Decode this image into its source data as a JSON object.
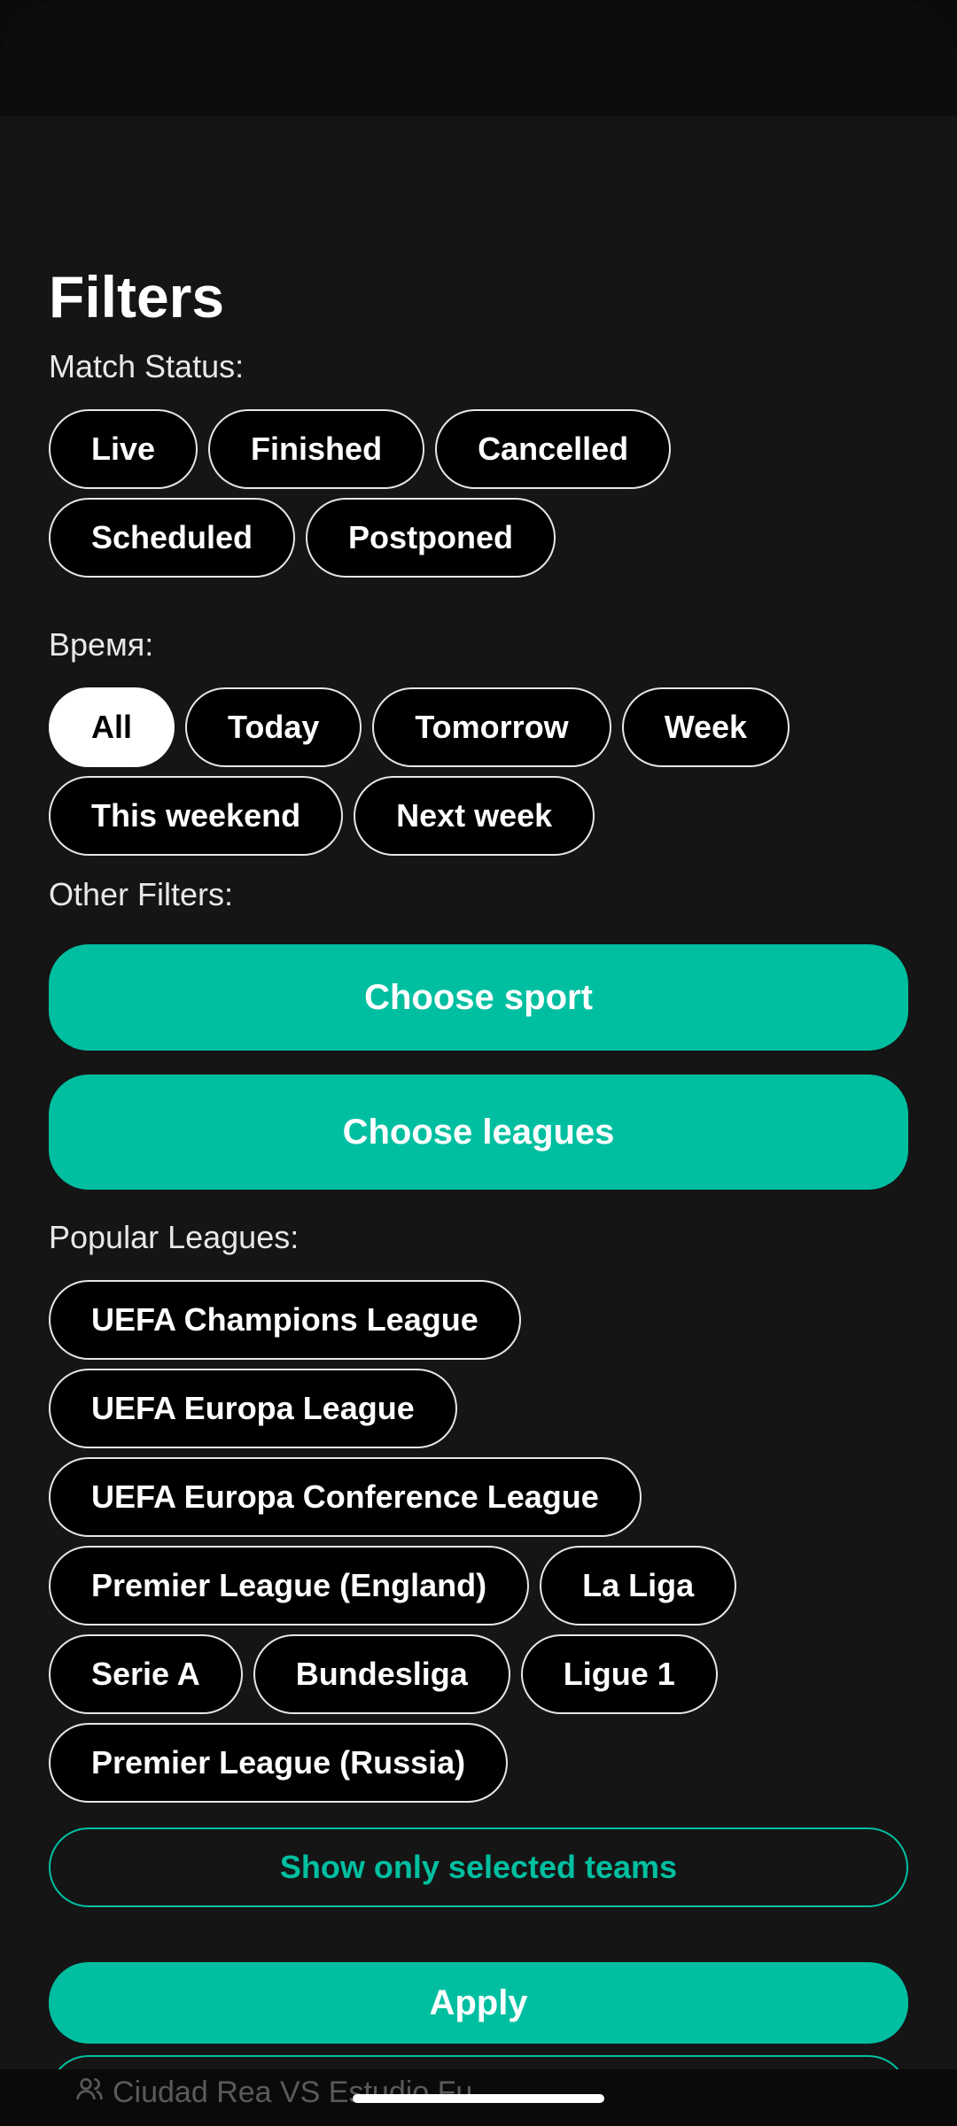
{
  "filters": {
    "title": "Filters",
    "match_status": {
      "label": "Match Status:",
      "options": [
        "Live",
        "Finished",
        "Cancelled",
        "Scheduled",
        "Postponed"
      ]
    },
    "time": {
      "label": "Время:",
      "options": [
        "All",
        "Today",
        "Tomorrow",
        "Week",
        "This weekend",
        "Next week"
      ],
      "selected": "All"
    },
    "other_filters": {
      "label": "Other Filters:",
      "choose_sport": "Choose sport",
      "choose_leagues": "Choose leagues"
    },
    "popular_leagues": {
      "label": "Popular Leagues:",
      "options": [
        "UEFA Champions League",
        "UEFA Europa League",
        "UEFA Europa Conference League",
        "Premier League (England)",
        "La Liga",
        "Serie A",
        "Bundesliga",
        "Ligue 1",
        "Premier League (Russia)"
      ]
    },
    "show_only_selected_teams": "Show only selected teams",
    "apply": "Apply"
  },
  "background": {
    "match_text": "Ciudad Rea VS Estudio Fu",
    "icon": "users-icon"
  },
  "colors": {
    "accent": "#00bfa0",
    "sheet_background": "#151515",
    "chip_background": "#000000",
    "chip_selected_background": "#ffffff"
  }
}
